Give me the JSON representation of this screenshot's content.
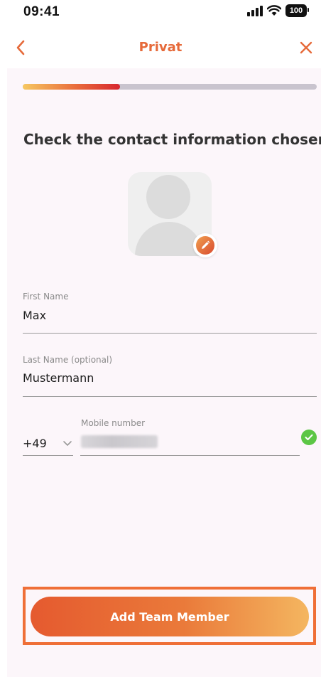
{
  "status_bar": {
    "time": "09:41",
    "battery": "100"
  },
  "nav": {
    "title": "Privat",
    "back_icon": "chevron-left-icon",
    "close_icon": "close-icon",
    "accent_color": "#e66a3a"
  },
  "progress": {
    "fraction": 0.33
  },
  "form": {
    "heading": "Check the contact information chosen is c",
    "first_name": {
      "label": "First Name",
      "value": "Max"
    },
    "last_name": {
      "label": "Last Name (optional)",
      "value": "Mustermann"
    },
    "phone": {
      "country_code": "+49",
      "label": "Mobile number",
      "status_icon": "check-circle-icon"
    }
  },
  "cta": {
    "label": "Add Team Member"
  }
}
